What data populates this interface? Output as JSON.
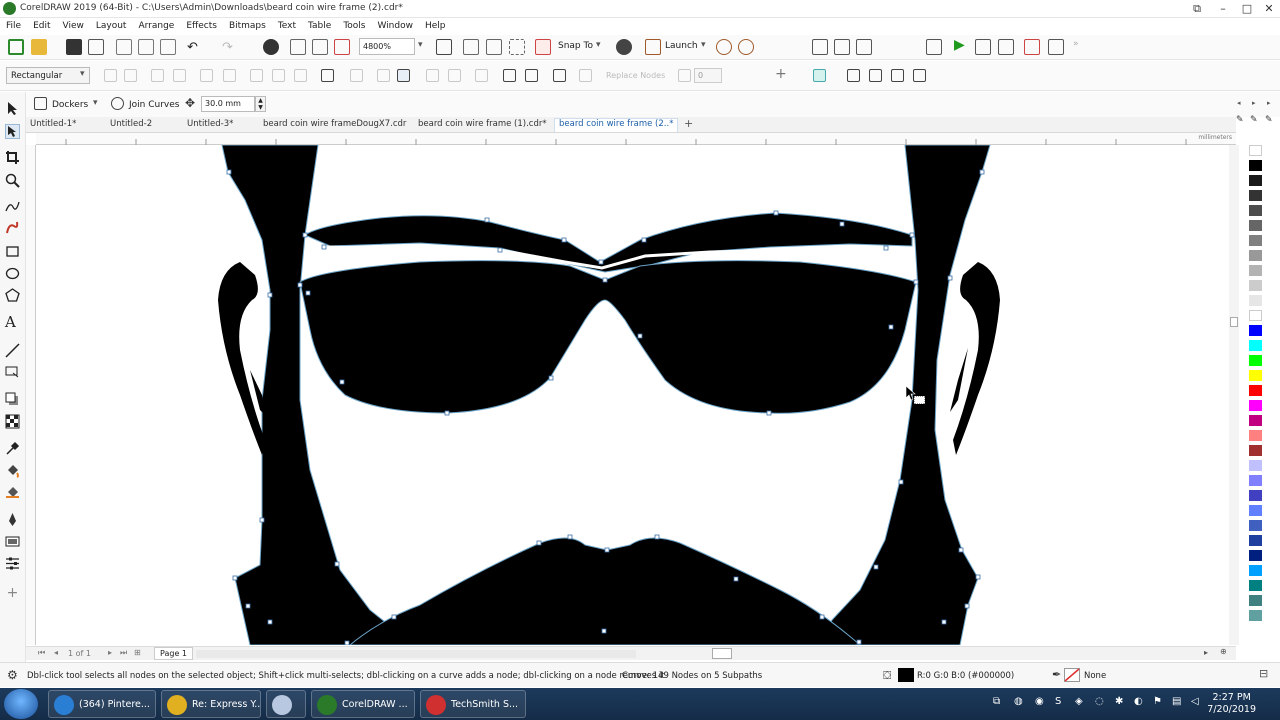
{
  "window": {
    "title": "CorelDRAW 2019 (64-Bit) - C:\\Users\\Admin\\Downloads\\beard coin wire frame (2).cdr*"
  },
  "menu": [
    "File",
    "Edit",
    "View",
    "Layout",
    "Arrange",
    "Effects",
    "Bitmaps",
    "Text",
    "Table",
    "Tools",
    "Window",
    "Help"
  ],
  "toolbar": {
    "zoom": "4800%",
    "snap_to": "Snap To",
    "launch": "Launch"
  },
  "property_bar": {
    "selection_mode": "Rectangular",
    "replace_nodes": "Replace Nodes",
    "reduce_value": "0"
  },
  "toolbar3": {
    "dockers": "Dockers",
    "join_curves": "Join Curves",
    "distance": "30.0 mm"
  },
  "tabs": [
    "Untitled-1*",
    "Untitled-2",
    "Untitled-3*",
    "beard coin wire frameDougX7.cdr",
    "beard coin wire frame (1).cdr*",
    "beard coin wire frame (2..*"
  ],
  "active_tab": 5,
  "ruler": {
    "unit": "millimeters"
  },
  "pagebar": {
    "page_of": "1 of 1",
    "page_label": "Page 1"
  },
  "status": {
    "hint": "Dbl-click tool selects all nodes on the selected object; Shift+click multi-selects; dbl-clicking on a curve adds a node; dbl-clicking on a node removes it",
    "curve_info": "Curve: 149 Nodes on 5 Subpaths",
    "fill": "R:0 G:0 B:0 (#000000)",
    "outline": "None"
  },
  "taskbar": {
    "items": [
      {
        "label": "(364) Pintere...",
        "icon": "internet-explorer-icon",
        "color": "#2a7fd4"
      },
      {
        "label": "Re: Express Y...",
        "icon": "chrome-icon",
        "color": "#e0b020"
      },
      {
        "label": "",
        "icon": "snipping-icon",
        "color": "#b8c8e0"
      },
      {
        "label": "CorelDRAW ...",
        "icon": "coreldraw-icon",
        "color": "#2a7a2a"
      },
      {
        "label": "TechSmith S...",
        "icon": "techsmith-icon",
        "color": "#d03030"
      }
    ],
    "time": "2:27 PM",
    "date": "7/20/2019"
  },
  "palette_colors": [
    "#ffffff",
    "#000000",
    "#1a1a1a",
    "#333333",
    "#4d4d4d",
    "#666666",
    "#808080",
    "#999999",
    "#b3b3b3",
    "#cccccc",
    "#e6e6e6",
    "#ffffff",
    "#0000ff",
    "#00ffff",
    "#00ff00",
    "#ffff00",
    "#ff0000",
    "#ff00ff",
    "#c00080",
    "#ff8080",
    "#a03030",
    "#c0c0ff",
    "#8080ff",
    "#4040c0",
    "#6080ff",
    "#4060c0",
    "#2040a0",
    "#002080",
    "#00a0ff",
    "#008080",
    "#408080",
    "#60a0a0"
  ]
}
